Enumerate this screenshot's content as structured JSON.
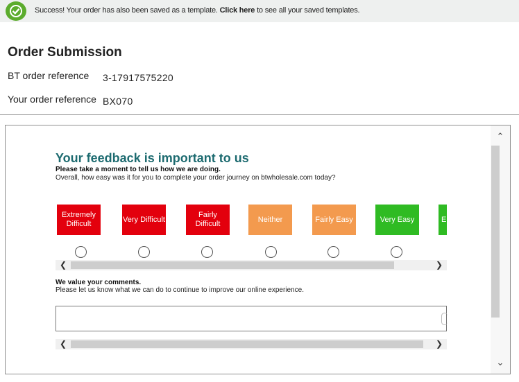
{
  "banner": {
    "icon": "check-circle-icon",
    "message_before": "Success! Your order has also been saved as a template. ",
    "link_text": "Click here",
    "message_after": " to see all your saved templates.",
    "accent_color": "#5cac2d"
  },
  "order": {
    "title": "Order Submission",
    "bt_ref_label": "BT order reference",
    "bt_ref_value": "3-17917575220",
    "your_ref_label": "Your order reference",
    "your_ref_value": "BX070"
  },
  "feedback": {
    "title": "Your feedback is important to us",
    "subtitle": "Please take a moment to tell us how we are doing.",
    "question": "Overall, how easy was it for you to complete your order journey on btwholesale.com today?",
    "options": [
      {
        "label": "Extremely Difficult",
        "color": "#e3000d"
      },
      {
        "label": "Very Difficult",
        "color": "#e3000d"
      },
      {
        "label": "Fairly Difficult",
        "color": "#e3000d"
      },
      {
        "label": "Neither",
        "color": "#f39a4e"
      },
      {
        "label": "Fairly Easy",
        "color": "#f39a4e"
      },
      {
        "label": "Very Easy",
        "color": "#2fbb23"
      },
      {
        "label": "E",
        "color": "#2fbb23"
      }
    ],
    "comments_title": "We value your comments.",
    "comments_hint": "Please let us know what we can do to continue to improve our online experience.",
    "comments_value": ""
  },
  "scrollbars": {
    "up_icon": "chevron-up-icon",
    "down_icon": "chevron-down-icon",
    "left_icon": "chevron-left-icon",
    "right_icon": "chevron-right-icon"
  }
}
